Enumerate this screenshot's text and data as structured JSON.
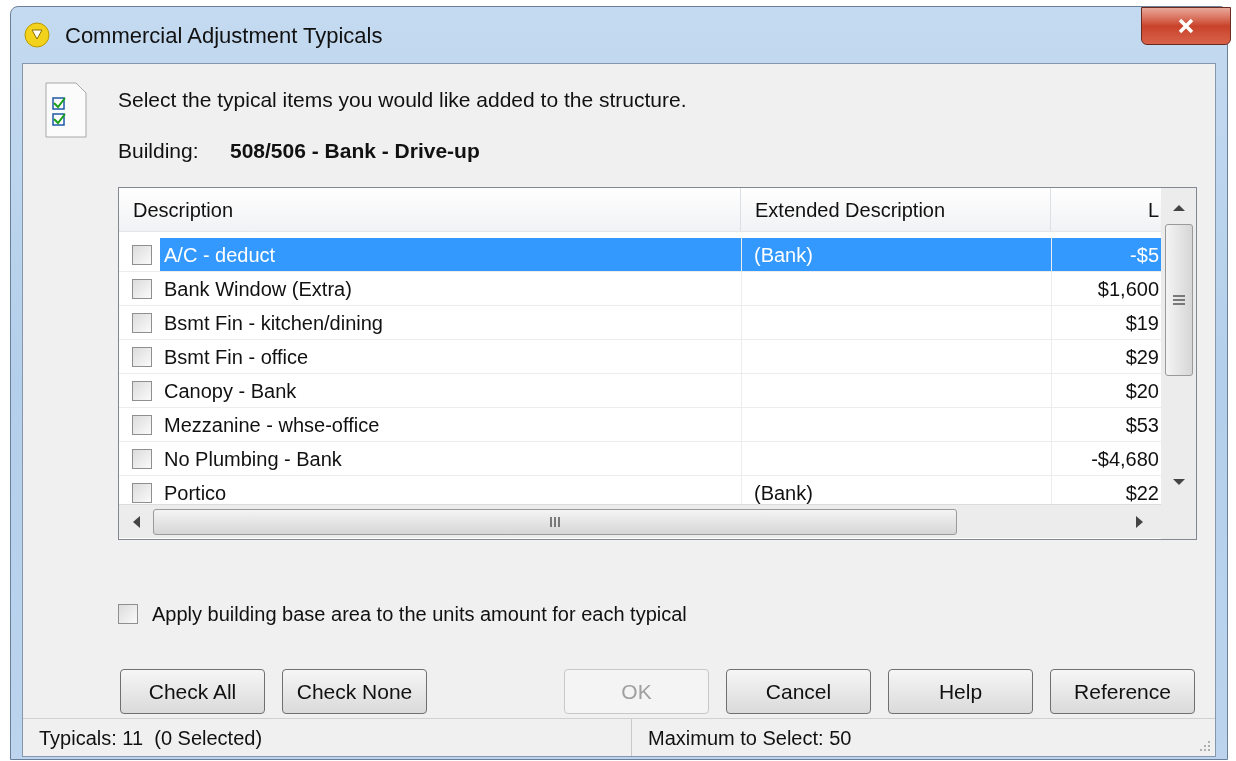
{
  "window": {
    "title": "Commercial Adjustment Typicals"
  },
  "instruction": "Select the typical items you would like added to the structure.",
  "building": {
    "label": "Building:",
    "value": "508/506 - Bank - Drive-up"
  },
  "table": {
    "columns": [
      "Description",
      "Extended Description",
      "L"
    ],
    "rows": [
      {
        "checked": false,
        "selected": true,
        "cells": [
          "A/C - deduct",
          "(Bank)",
          "-$5"
        ]
      },
      {
        "checked": false,
        "selected": false,
        "cells": [
          "Bank Window (Extra)",
          "",
          "$1,600"
        ]
      },
      {
        "checked": false,
        "selected": false,
        "cells": [
          "Bsmt Fin - kitchen/dining",
          "",
          "$19"
        ]
      },
      {
        "checked": false,
        "selected": false,
        "cells": [
          "Bsmt Fin - office",
          "",
          "$29"
        ]
      },
      {
        "checked": false,
        "selected": false,
        "cells": [
          "Canopy - Bank",
          "",
          "$20"
        ]
      },
      {
        "checked": false,
        "selected": false,
        "cells": [
          "Mezzanine - whse-office",
          "",
          "$53"
        ]
      },
      {
        "checked": false,
        "selected": false,
        "cells": [
          "No Plumbing - Bank",
          "",
          "-$4,680"
        ]
      },
      {
        "checked": false,
        "selected": false,
        "cells": [
          "Portico",
          "(Bank)",
          "$22"
        ]
      }
    ]
  },
  "apply_option": {
    "label": "Apply building base area to the units amount for each typical",
    "checked": false
  },
  "buttons": [
    {
      "label": "Check All",
      "disabled": false
    },
    {
      "label": "Check None",
      "disabled": false
    },
    {
      "label": "OK",
      "disabled": true
    },
    {
      "label": "Cancel",
      "disabled": false
    },
    {
      "label": "Help",
      "disabled": false
    },
    {
      "label": "Reference",
      "disabled": false
    }
  ],
  "status_bar": [
    "Typicals: 11  (0 Selected)",
    "Maximum to Select: 50"
  ]
}
